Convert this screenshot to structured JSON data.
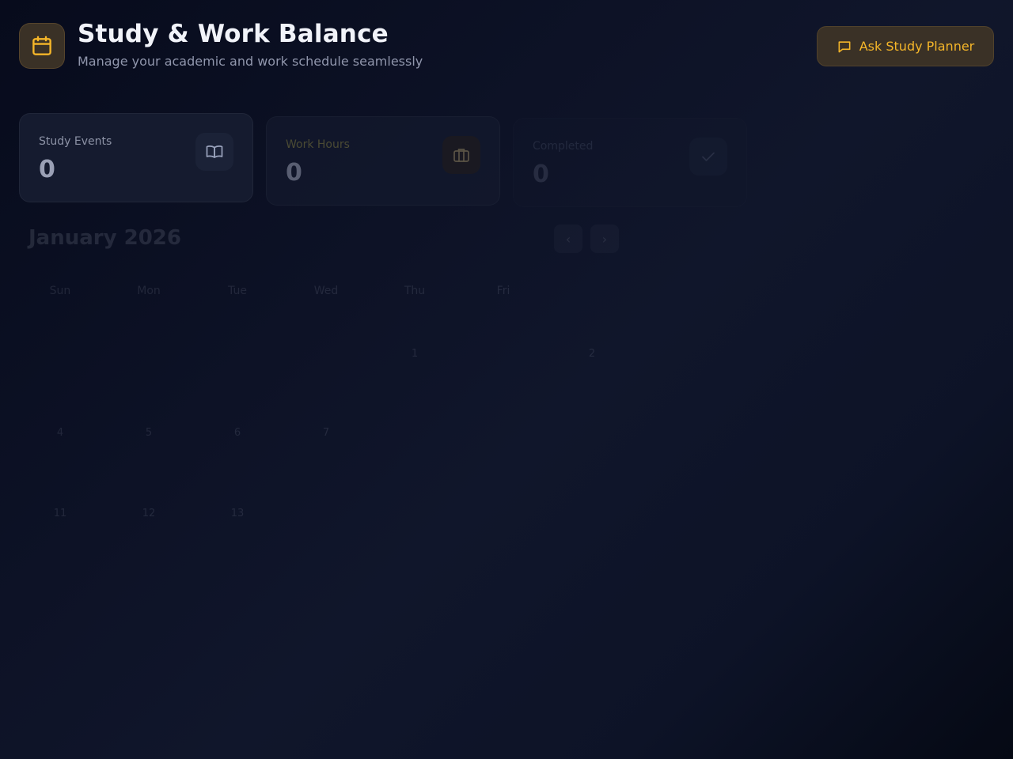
{
  "header": {
    "title": "Study & Work Balance",
    "subtitle": "Manage your academic and work schedule seamlessly",
    "logo_icon": "calendar-icon",
    "planner_button": {
      "label": "Ask Study Planner",
      "icon": "chat-bubble-icon"
    }
  },
  "stats": [
    {
      "label": "Study Events",
      "value": "0",
      "icon": "book-open-icon"
    },
    {
      "label": "Work Hours",
      "value": "0",
      "icon": "briefcase-icon"
    },
    {
      "label": "Completed",
      "value": "0",
      "icon": "check-icon"
    }
  ],
  "calendar": {
    "month_label": "January 2026",
    "prev_label": "‹",
    "next_label": "›",
    "weekdays": [
      "Sun",
      "Mon",
      "Tue",
      "Wed",
      "Thu",
      "Fri"
    ],
    "week1": [
      "1",
      "2"
    ],
    "week2": [
      "4",
      "5",
      "6",
      "7"
    ],
    "week3": [
      "11",
      "12",
      "13"
    ]
  },
  "colors": {
    "accent": "#f5b629",
    "background": "#0d1226",
    "card": "#151b2f",
    "muted_text": "#9096ac"
  }
}
